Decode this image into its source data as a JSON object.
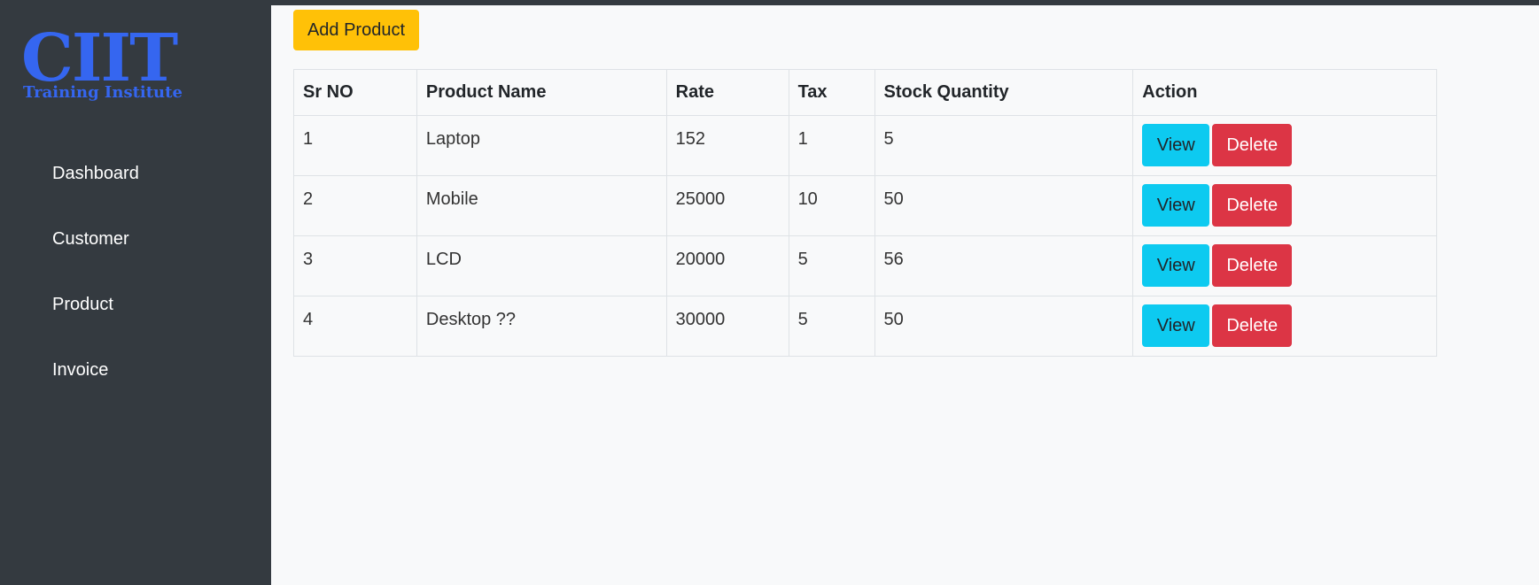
{
  "brand": {
    "logo_main": "CIIT",
    "logo_sub": "Training Institute",
    "logo_color": "#3566f0"
  },
  "sidebar": {
    "items": [
      {
        "label": "Dashboard"
      },
      {
        "label": "Customer"
      },
      {
        "label": "Product"
      },
      {
        "label": "Invoice"
      }
    ]
  },
  "toolbar": {
    "add_label": "Add Product"
  },
  "table": {
    "headers": [
      "Sr NO",
      "Product Name",
      "Rate",
      "Tax",
      "Stock Quantity",
      "Action"
    ],
    "rows": [
      {
        "sr": "1",
        "name": "Laptop",
        "rate": "152",
        "tax": "1",
        "stock": "5",
        "view": "View",
        "delete": "Delete"
      },
      {
        "sr": "2",
        "name": "Mobile",
        "rate": "25000",
        "tax": "10",
        "stock": "50",
        "view": "View",
        "delete": "Delete"
      },
      {
        "sr": "3",
        "name": "LCD",
        "rate": "20000",
        "tax": "5",
        "stock": "56",
        "view": "View",
        "delete": "Delete"
      },
      {
        "sr": "4",
        "name": "Desktop ??",
        "rate": "30000",
        "tax": "5",
        "stock": "50",
        "view": "View",
        "delete": "Delete"
      }
    ]
  },
  "colors": {
    "sidebar_bg": "#343a40",
    "page_bg": "#f8f9fa",
    "warning": "#ffc107",
    "info": "#0dcaf0",
    "danger": "#dc3545"
  }
}
